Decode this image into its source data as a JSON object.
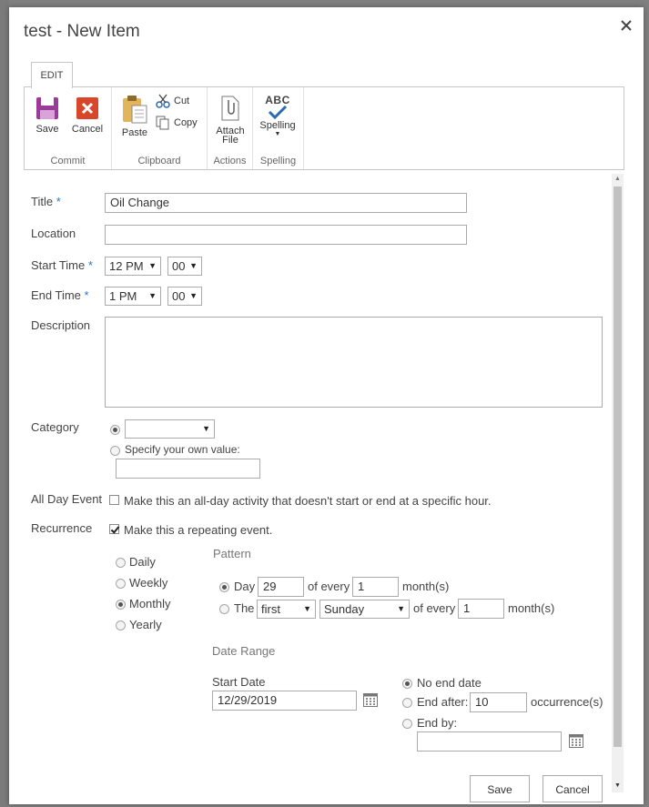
{
  "dialog": {
    "title": "test - New Item",
    "close_symbol": "✕"
  },
  "ribbon": {
    "tab": "EDIT",
    "groups": {
      "commit": "Commit",
      "clipboard": "Clipboard",
      "actions": "Actions",
      "spelling": "Spelling"
    },
    "buttons": {
      "save": "Save",
      "cancel": "Cancel",
      "paste": "Paste",
      "cut": "Cut",
      "copy": "Copy",
      "attach_line1": "Attach",
      "attach_line2": "File",
      "spelling_abc": "ABC",
      "spelling": "Spelling"
    }
  },
  "form": {
    "title_label": "Title",
    "title_value": "Oil Change",
    "location_label": "Location",
    "location_value": "",
    "start_time_label": "Start Time",
    "start_hour": "12 PM",
    "start_minute": "00",
    "end_time_label": "End Time",
    "end_hour": "1 PM",
    "end_minute": "00",
    "description_label": "Description",
    "description_value": "",
    "category_label": "Category",
    "category_selected": "",
    "category_own_label": "Specify your own value:",
    "category_own_value": "",
    "all_day_label": "All Day Event",
    "all_day_text": "Make this an all-day activity that doesn't start or end at a specific hour.",
    "all_day_checked": false,
    "recurrence_label": "Recurrence",
    "recurrence_text": "Make this a repeating event.",
    "recurrence_checked": true,
    "required_mark": "*"
  },
  "recurrence": {
    "frequencies": [
      "Daily",
      "Weekly",
      "Monthly",
      "Yearly"
    ],
    "selected_frequency": "Monthly",
    "pattern_heading": "Pattern",
    "day_label": "Day",
    "day_value": "29",
    "of_every_1": "of every",
    "month_interval_1": "1",
    "months_1": "month(s)",
    "the_label": "The",
    "ordinal": "first",
    "weekday": "Sunday",
    "of_every_2": "of every",
    "month_interval_2": "1",
    "months_2": "month(s)",
    "date_range_heading": "Date Range",
    "start_date_label": "Start Date",
    "start_date_value": "12/29/2019",
    "no_end_label": "No end date",
    "end_after_label": "End after:",
    "end_after_value": "10",
    "occurrences_label": "occurrence(s)",
    "end_by_label": "End by:",
    "end_by_value": ""
  },
  "footer": {
    "save": "Save",
    "cancel": "Cancel"
  }
}
